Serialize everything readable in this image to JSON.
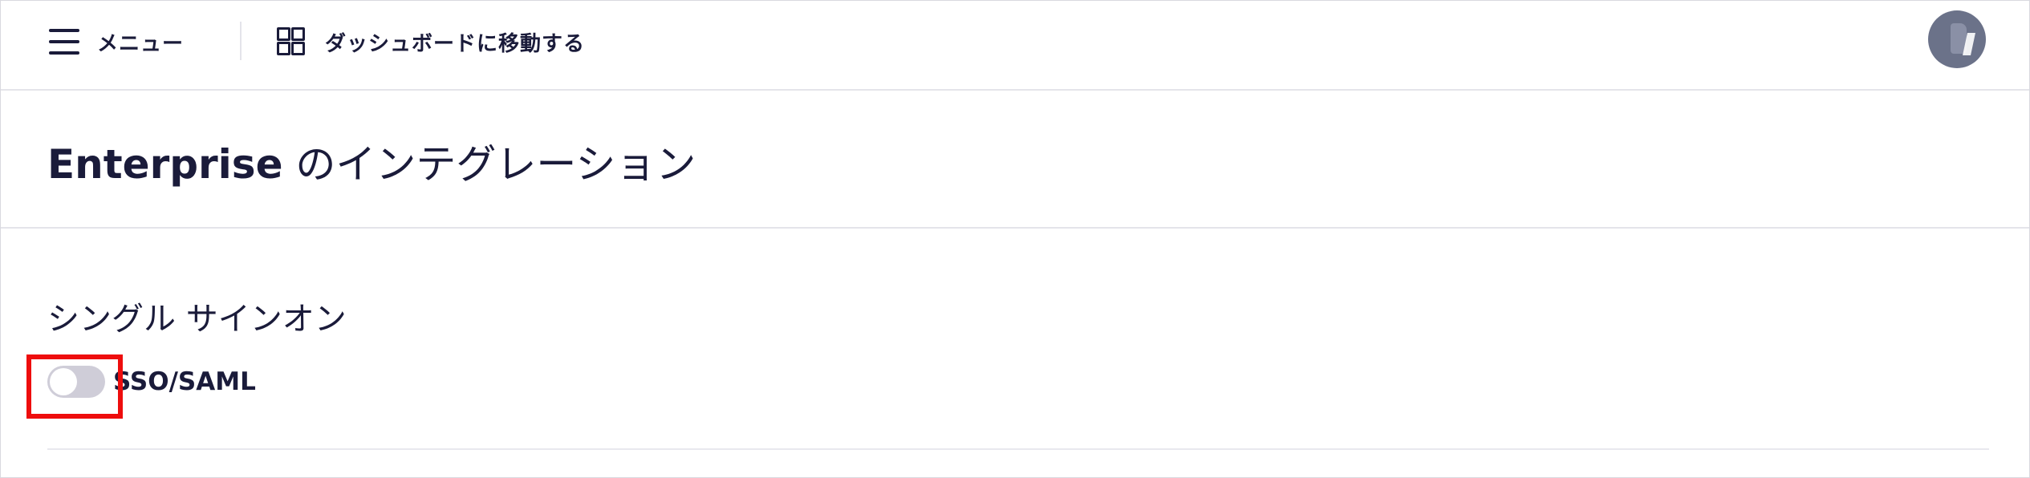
{
  "topbar": {
    "menu_label": "メニュー",
    "menu_icon": "hamburger-icon",
    "dashboard_label": "ダッシュボードに移動する",
    "dashboard_icon": "grid-icon",
    "avatar_icon": "user-avatar"
  },
  "page": {
    "title_en": "Enterprise",
    "title_jp": " のインテグレーション"
  },
  "section": {
    "title": "シングル サインオン",
    "toggle": {
      "label": "SSO/SAML",
      "state": "off"
    }
  },
  "colors": {
    "text": "#1a1b3a",
    "divider": "#e4e4ea",
    "toggle_off": "#cfcdd8",
    "highlight": "#ee0d0d",
    "avatar": "#6b7289"
  }
}
